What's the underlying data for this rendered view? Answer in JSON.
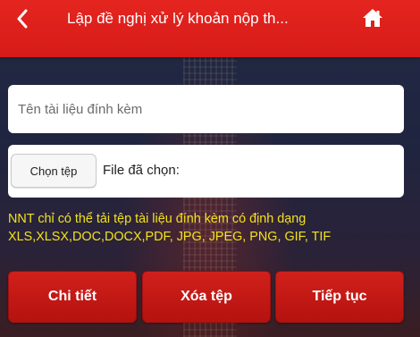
{
  "header": {
    "title": "Lập đề nghị xử lý khoản nộp th...",
    "back_icon": "chevron-left-icon",
    "home_icon": "home-icon"
  },
  "form": {
    "attachment_name_placeholder": "Tên tài liệu đính kèm",
    "attachment_name_value": "",
    "choose_file_label": "Chọn tệp",
    "file_selected_label": "File đã chọn:",
    "file_selected_value": ""
  },
  "note": {
    "line1": "NNT chỉ có thể tải tệp tài liệu đính kèm có định dạng",
    "line2": "XLS,XLSX,DOC,DOCX,PDF, JPG, JPEG, PNG, GIF, TIF"
  },
  "actions": {
    "detail_label": "Chi tiết",
    "delete_label": "Xóa tệp",
    "next_label": "Tiếp tục"
  },
  "colors": {
    "header_red": "#e5251f",
    "button_red": "#c4170f",
    "note_yellow": "#f2e21c",
    "background_navy": "#232a44"
  }
}
